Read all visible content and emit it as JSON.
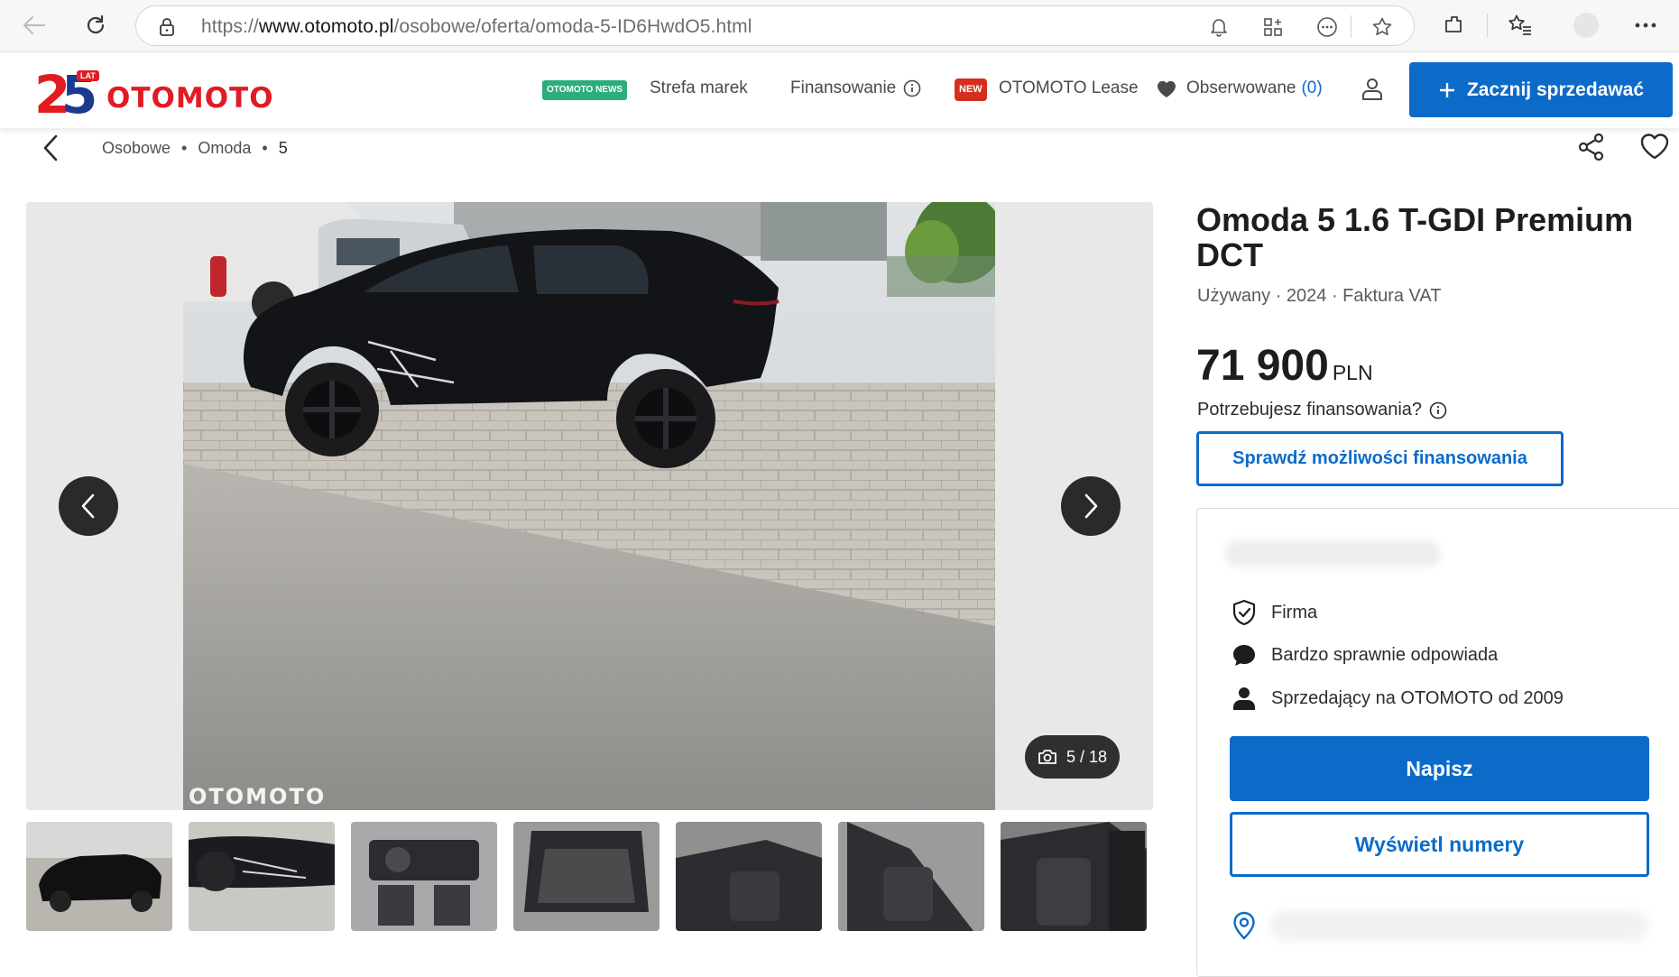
{
  "browser": {
    "url_prefix": "https://",
    "url_domain": "www.otomoto.pl",
    "url_path": "/osobowe/oferta/omoda-5-ID6HwdO5.html"
  },
  "header": {
    "logo_text": "OTOMOTO",
    "logo_badge": "LAT",
    "news_tag": "OTOMOTO NEWS",
    "brands_label": "Strefa marek",
    "financing_label": "Finansowanie",
    "new_tag": "NEW",
    "lease_label": "OTOMOTO Lease",
    "watched_label": "Obserwowane",
    "watched_count": "(0)",
    "sell_button": "Zacznij sprzedawać"
  },
  "breadcrumb": [
    "Osobowe",
    "Omoda",
    "5"
  ],
  "gallery": {
    "counter": "5 / 18",
    "watermark": "OTOMOTO",
    "thumbnail_count": 7
  },
  "listing": {
    "title": "Omoda 5 1.6 T-GDI Premium DCT",
    "meta": "Używany · 2024 · Faktura VAT",
    "price": "71 900",
    "currency": "PLN",
    "financing_question": "Potrzebujesz finansowania?",
    "financing_button": "Sprawdź możliwości finansowania"
  },
  "seller": {
    "features": [
      {
        "icon": "shield-check-icon",
        "label": "Firma"
      },
      {
        "icon": "chat-bubble-icon",
        "label": "Bardzo sprawnie odpowiada"
      },
      {
        "icon": "person-icon",
        "label": "Sprzedający na OTOMOTO od 2009"
      }
    ],
    "write_button": "Napisz",
    "phone_button": "Wyświetl numery"
  },
  "colors": {
    "brand_red": "#e21b22",
    "primary_blue": "#0c6bc9",
    "news_green": "#2bae79"
  }
}
